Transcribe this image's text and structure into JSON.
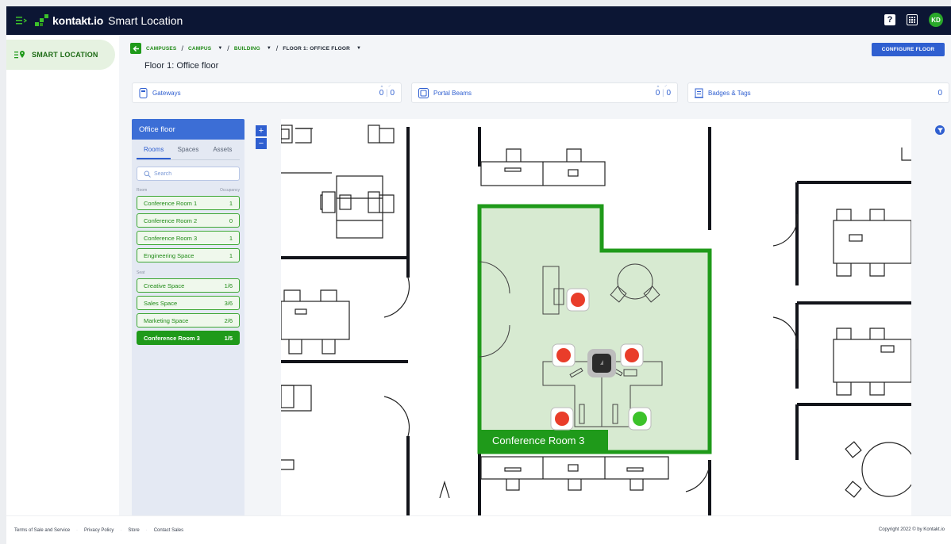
{
  "topbar": {
    "brand": "kontakt.io",
    "product": "Smart Location",
    "help_label": "?",
    "avatar_initials": "KD",
    "brand_color": "#0c1634",
    "accent_color": "#2aa82a"
  },
  "sidebar": {
    "items": [
      {
        "label": "SMART LOCATION",
        "icon": "location-list-icon"
      }
    ]
  },
  "breadcrumb": {
    "items": [
      "CAMPUSES",
      "CAMPUS",
      "BUILDING",
      "FLOOR 1: OFFICE FLOOR"
    ]
  },
  "page": {
    "title": "Floor 1: Office floor",
    "configure_label": "CONFIGURE FLOOR"
  },
  "stats": [
    {
      "label": "Gateways",
      "value_a": "0",
      "value_b": "0",
      "icon": "gateway-icon"
    },
    {
      "label": "Portal Beams",
      "value_a": "0",
      "value_b": "0",
      "icon": "portal-beam-icon"
    },
    {
      "label": "Badges & Tags",
      "value": "0",
      "icon": "badge-icon"
    }
  ],
  "panel": {
    "floor_name": "Office floor",
    "tabs": [
      "Rooms",
      "Spaces",
      "Assets"
    ],
    "active_tab": "Rooms",
    "search_placeholder": "Search",
    "col_room": "Room",
    "col_occupancy": "Occupancy",
    "rooms": [
      {
        "name": "Conference Room 1",
        "occupancy": "1"
      },
      {
        "name": "Conference Room 2",
        "occupancy": "0"
      },
      {
        "name": "Conference Room 3",
        "occupancy": "1"
      },
      {
        "name": "Engineering Space",
        "occupancy": "1"
      }
    ],
    "seat_label": "Seat",
    "seats": [
      {
        "name": "Creative Space",
        "occupancy": "1/6"
      },
      {
        "name": "Sales Space",
        "occupancy": "3/6"
      },
      {
        "name": "Marketing Space",
        "occupancy": "2/6"
      },
      {
        "name": "Conference Room 3",
        "occupancy": "1/5",
        "active": true
      }
    ]
  },
  "zoom": {
    "in_label": "+",
    "out_label": "−"
  },
  "map": {
    "highlighted_room": "Conference Room 3",
    "seat_status": {
      "occupied_color": "#e93d2a",
      "free_color": "#3cc22a",
      "occupied_count": 4,
      "free_count": 1
    }
  },
  "footer": {
    "links": [
      "Terms of Sale and Service",
      "Privacy Policy",
      "Store",
      "Contact Sales"
    ],
    "copyright": "Copyright 2022 © by Kontakt.io"
  }
}
